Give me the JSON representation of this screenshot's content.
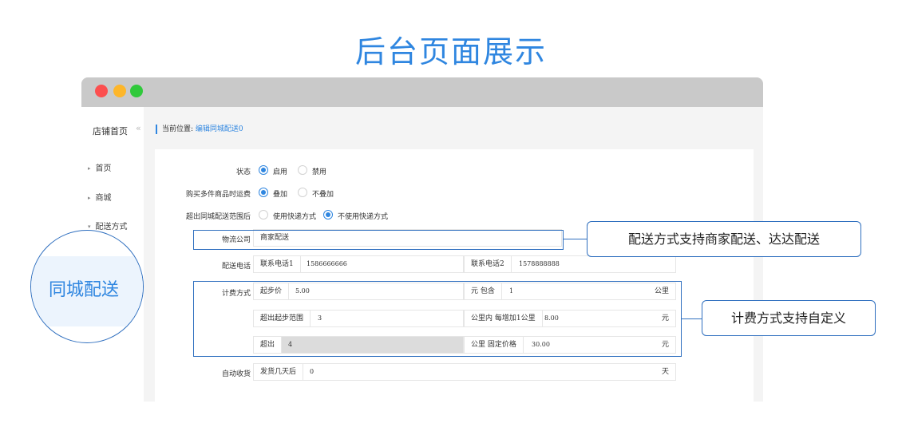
{
  "page_title": "后台页面展示",
  "sidebar": {
    "home": "店铺首页",
    "collapse_glyph": "«",
    "items": [
      {
        "label": "首页"
      },
      {
        "label": "商城"
      },
      {
        "label": "配送方式"
      }
    ],
    "active_zoom_label": "同城配送"
  },
  "breadcrumb": {
    "prefix": "当前位置:",
    "link": "编辑同城配送0"
  },
  "form": {
    "status": {
      "label": "状态",
      "options": [
        "启用",
        "禁用"
      ],
      "selected": "启用"
    },
    "multi_item": {
      "label": "购买多件商品时运费",
      "options": [
        "叠加",
        "不叠加"
      ],
      "selected": "叠加"
    },
    "beyond_range": {
      "label": "超出同城配送范围后",
      "options": [
        "使用快递方式",
        "不使用快递方式"
      ],
      "selected": "不使用快递方式"
    },
    "logistics": {
      "label": "物流公司",
      "value": "商家配送"
    },
    "phone": {
      "label": "配送电话",
      "phone1_label": "联系电话1",
      "phone1": "1586666666",
      "phone2_label": "联系电话2",
      "phone2": "1578888888"
    },
    "billing": {
      "label": "计费方式",
      "start_price_label": "起步价",
      "start_price": "5.00",
      "include_label": "元 包含",
      "include_value": "1",
      "include_unit": "公里",
      "beyond_start_label": "超出起步范围",
      "beyond_start_value": "3",
      "per_km_label": "公里内 每增加1公里",
      "per_km_value": "8.00",
      "per_km_unit": "元",
      "beyond_label": "超出",
      "beyond_value": "4",
      "fixed_label": "公里 固定价格",
      "fixed_value": "30.00",
      "fixed_unit": "元"
    },
    "auto_receive": {
      "label": "自动收货",
      "pre": "发货几天后",
      "value": "0",
      "unit": "天"
    }
  },
  "callouts": {
    "delivery": "配送方式支持商家配送、达达配送",
    "billing": "计费方式支持自定义"
  },
  "colors": {
    "accent": "#2f86e0",
    "outline": "#2f6fbf",
    "titlebar": "#c9c9c9"
  }
}
